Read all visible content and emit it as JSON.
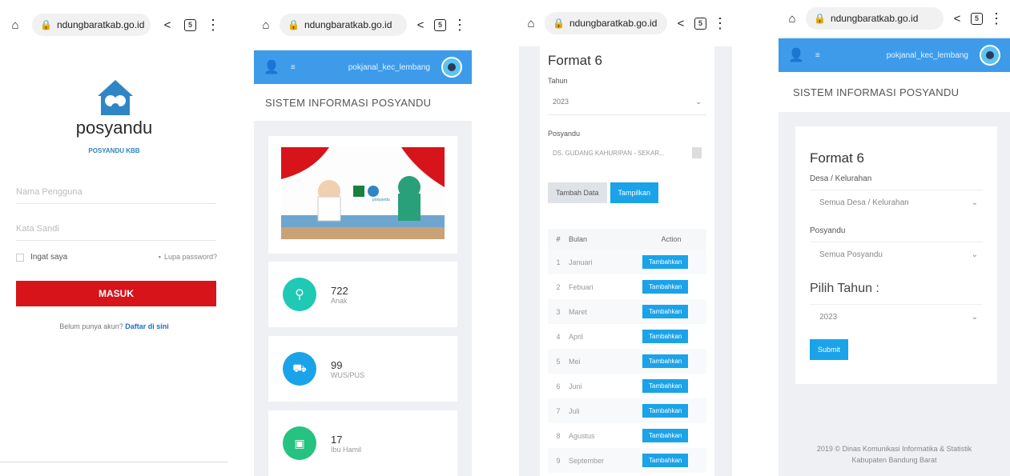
{
  "browser": {
    "url": "ndungbaratkab.go.id",
    "tabs_count": "5"
  },
  "login": {
    "brand": "posyandu",
    "subtitle": "POSYANDU KBB",
    "username_placeholder": "Nama Pengguna",
    "password_placeholder": "Kata Sandi",
    "remember": "Ingat saya",
    "forgot": "Lupa password?",
    "submit": "MASUK",
    "no_account": "Belum punya akun?",
    "register": "Daftar di sini"
  },
  "dashboard": {
    "user": "pokjanal_kec_lembang",
    "title": "SISTEM INFORMASI POSYANDU",
    "banner_caption": "posyandu",
    "stats": [
      {
        "value": "722",
        "label": "Anak",
        "color": "#1fc9b4"
      },
      {
        "value": "99",
        "label": "WUS/PUS",
        "color": "#1aa3e8"
      },
      {
        "value": "17",
        "label": "Ibu Hamil",
        "color": "#26c281"
      }
    ]
  },
  "format6": {
    "title": "Format 6",
    "year_label": "Tahun",
    "year_value": "2023",
    "posyandu_label": "Posyandu",
    "posyandu_value": "DS. GUDANG KAHURIPAN - SEKAR...",
    "add_button": "Tambah Data",
    "show_button": "Tampilkan",
    "columns": [
      "#",
      "Bulan",
      "Action"
    ],
    "row_action": "Tambahkan",
    "rows": [
      {
        "no": "1",
        "month": "Januari"
      },
      {
        "no": "2",
        "month": "Febuari"
      },
      {
        "no": "3",
        "month": "Maret"
      },
      {
        "no": "4",
        "month": "April"
      },
      {
        "no": "5",
        "month": "Mei"
      },
      {
        "no": "6",
        "month": "Juni"
      },
      {
        "no": "7",
        "month": "Juli"
      },
      {
        "no": "8",
        "month": "Agustus"
      },
      {
        "no": "9",
        "month": "September"
      }
    ]
  },
  "filter": {
    "user": "pokjanal_kec_lembang",
    "title": "SISTEM INFORMASI POSYANDU",
    "form_title": "Format 6",
    "desa_label": "Desa / Kelurahan",
    "desa_value": "Semua Desa / Kelurahan",
    "posyandu_label": "Posyandu",
    "posyandu_value": "Semua Posyandu",
    "year_label": "Pilih Tahun :",
    "year_value": "2023",
    "submit": "Submit",
    "footer_line1": "2019 © Dinas Komunikasi Informatika & Statistik",
    "footer_line2": "Kabupaten Bandung Barat"
  }
}
